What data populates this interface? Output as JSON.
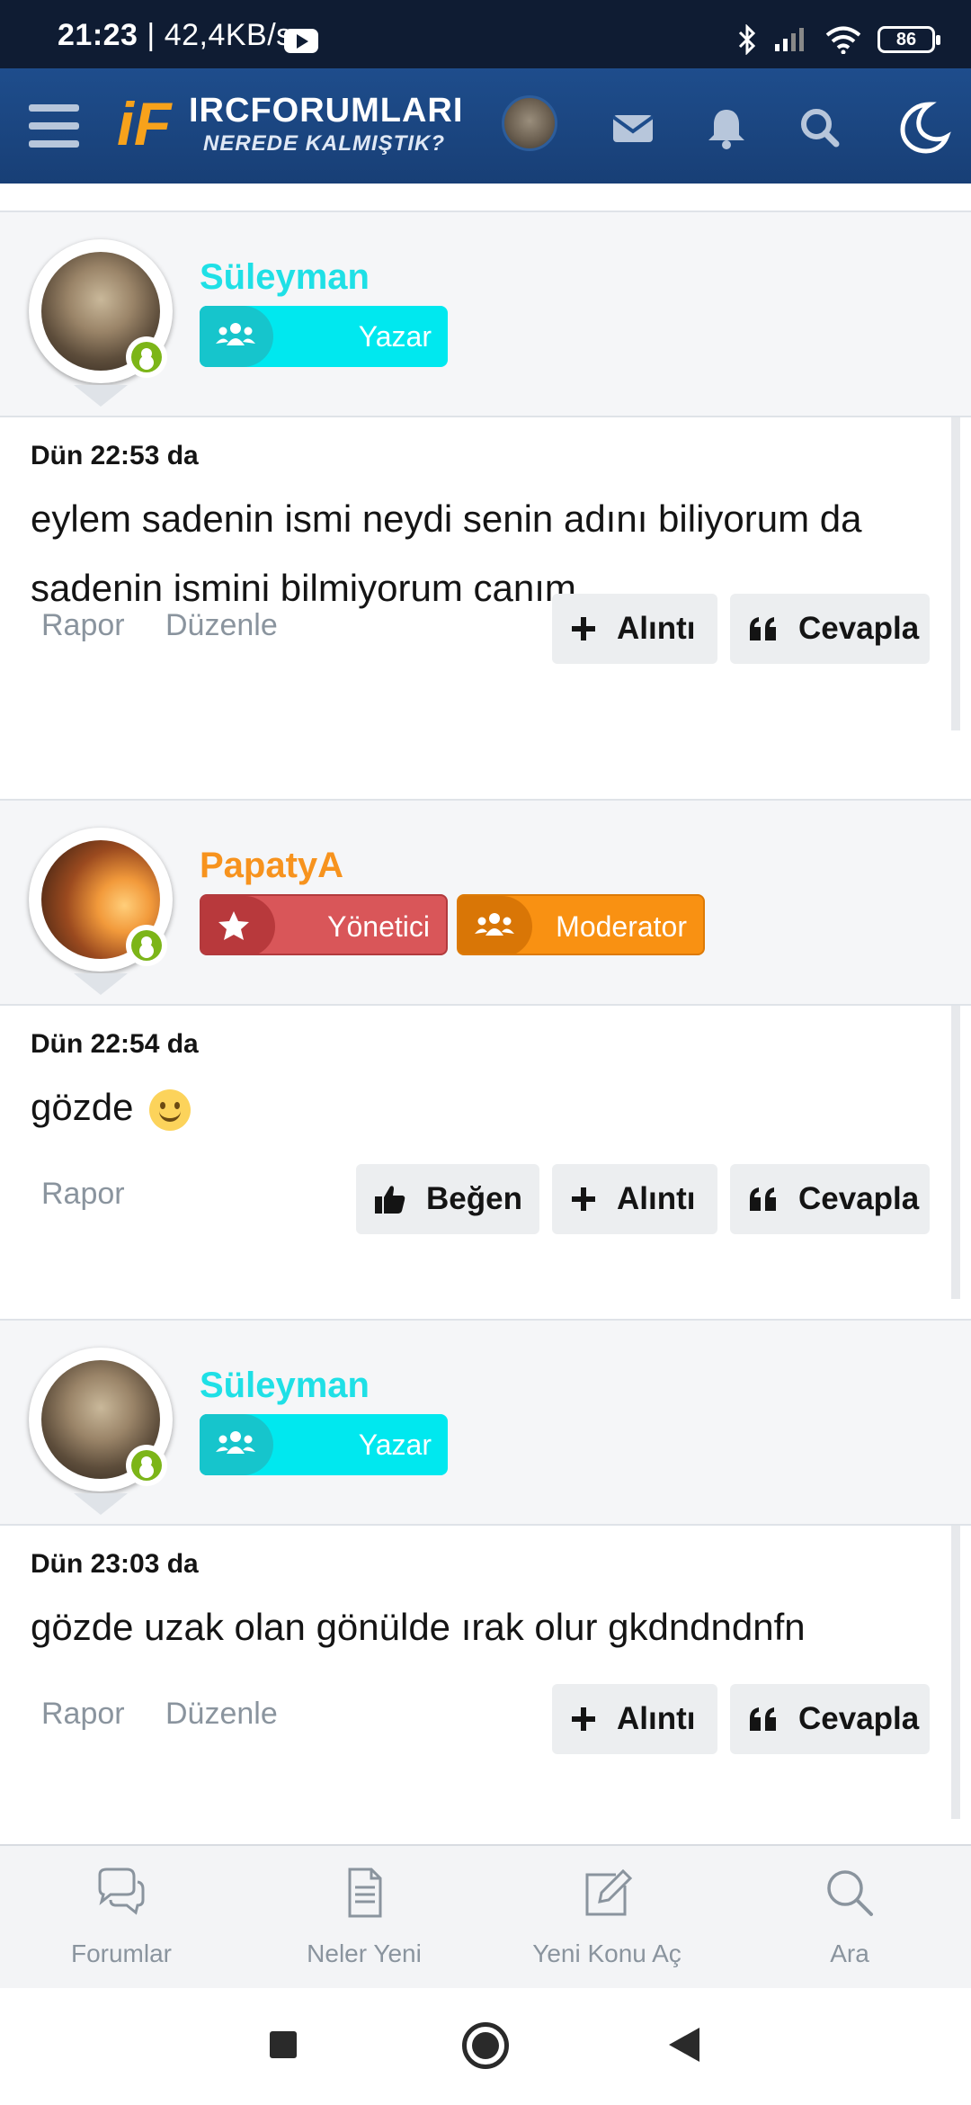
{
  "status_bar": {
    "time": "21:23",
    "speed": "| 42,4KB/s",
    "battery": "86"
  },
  "header": {
    "logo_title": "IRCFORUMLARI",
    "logo_subtitle": "NEREDE KALMIŞTIK?",
    "icons": [
      "menu-icon",
      "avatar",
      "mail-icon",
      "bell-icon",
      "search-icon",
      "moon-icon"
    ]
  },
  "posts": [
    {
      "username": "Süleyman",
      "username_color": "#1fe0e6",
      "badges": [
        {
          "label": "Yazar",
          "icon": "group-icon"
        }
      ],
      "date": "Dün 22:53 da",
      "text": "eylem sadenin ismi neydi senin adını biliyorum da sadenin ismini bilmiyorum canım",
      "links": [
        "Rapor",
        "Düzenle"
      ],
      "buttons": [
        "Alıntı",
        "Cevapla"
      ]
    },
    {
      "username": "PapatyA",
      "username_color": "#f7931e",
      "badges": [
        {
          "label": "Yönetici",
          "icon": "star-icon"
        },
        {
          "label": "Moderator",
          "icon": "group-icon"
        }
      ],
      "date": "Dün 22:54 da",
      "text": "gözde",
      "emoji": "slightly-smiling-face",
      "links": [
        "Rapor"
      ],
      "buttons": [
        "Beğen",
        "Alıntı",
        "Cevapla"
      ]
    },
    {
      "username": "Süleyman",
      "username_color": "#1fe0e6",
      "badges": [
        {
          "label": "Yazar",
          "icon": "group-icon"
        }
      ],
      "date": "Dün 23:03 da",
      "text": "gözde uzak olan gönülde ırak olur gkdndndnfn",
      "links": [
        "Rapor",
        "Düzenle"
      ],
      "buttons": [
        "Alıntı",
        "Cevapla"
      ]
    }
  ],
  "bottom_nav": [
    {
      "label": "Forumlar",
      "icon": "chat-bubbles-icon"
    },
    {
      "label": "Neler Yeni",
      "icon": "document-icon"
    },
    {
      "label": "Yeni Konu Aç",
      "icon": "edit-icon"
    },
    {
      "label": "Ara",
      "icon": "search-icon"
    }
  ]
}
